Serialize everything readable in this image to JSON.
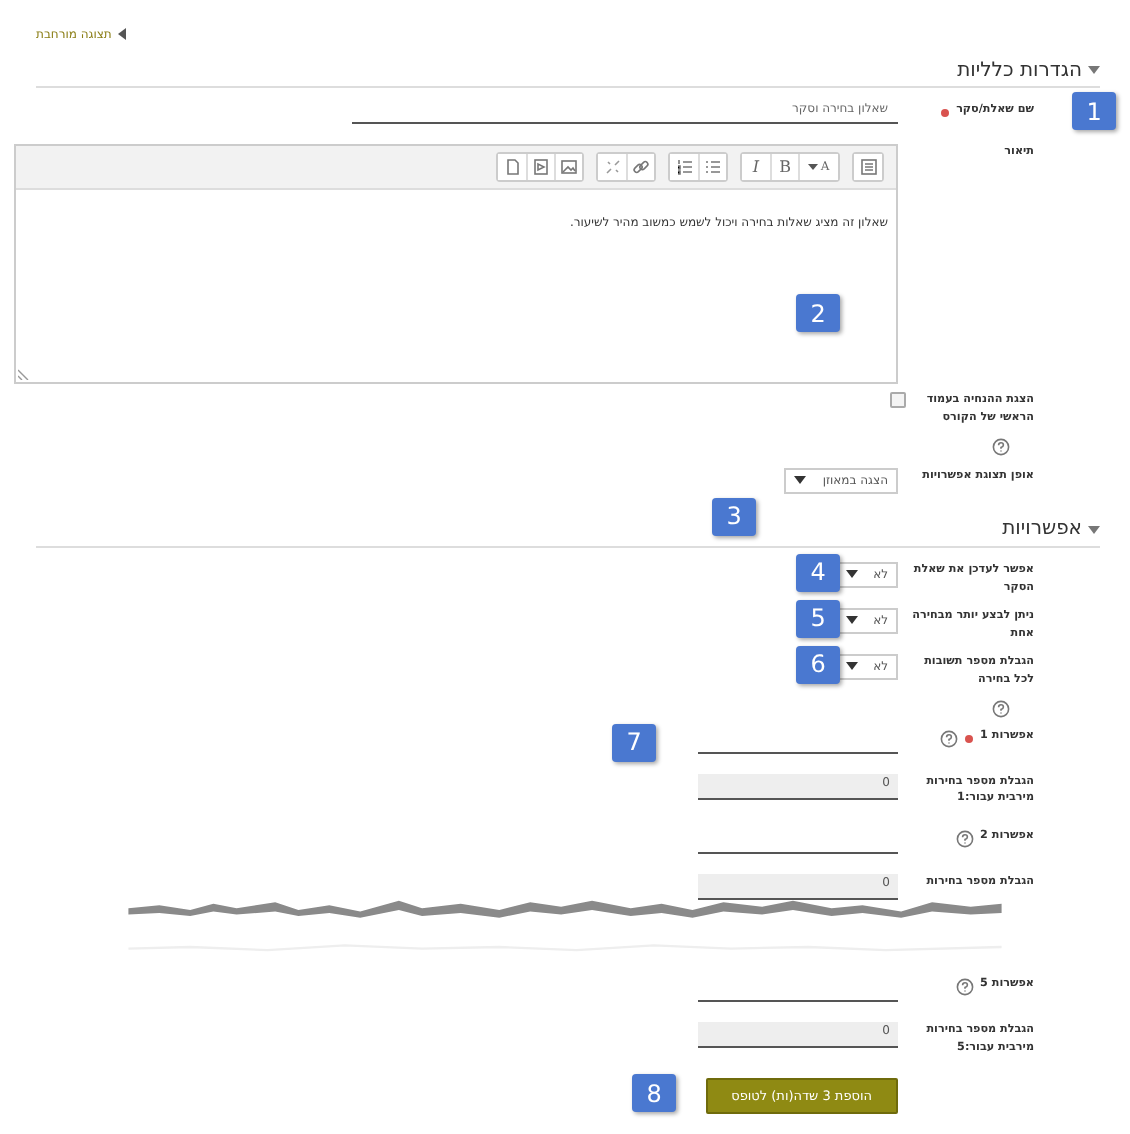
{
  "breadcrumb": {
    "label": "תצוגה מורחבת"
  },
  "sections": [
    {
      "title": "הגדרות כלליות",
      "expanded": true,
      "fields": [
        {
          "kind": "text",
          "label": "שם שאלת/סקר",
          "required": true,
          "value": "שאלון בחירה וסקר",
          "callout": "1"
        },
        {
          "kind": "editor",
          "label": "תיאור",
          "value": "שאלון זה מציג שאלות בחירה ויכול לשמש כמשוב מהיר לשיעור.",
          "callout": "2",
          "toolbar": [
            [
              {
                "kind": "more"
              }
            ],
            [
              {
                "kind": "style",
                "label": "A"
              },
              {
                "kind": "bold",
                "label": "B"
              },
              {
                "kind": "italic",
                "label": "I"
              }
            ],
            [
              {
                "kind": "ul"
              },
              {
                "kind": "ol"
              }
            ],
            [
              {
                "kind": "link"
              },
              {
                "kind": "unlink"
              }
            ],
            [
              {
                "kind": "image"
              },
              {
                "kind": "media"
              },
              {
                "kind": "file"
              }
            ]
          ]
        },
        {
          "kind": "checkbox",
          "label": "הצגת ההנחיה בעמוד הראשי של הקורס",
          "checked": false,
          "help": true
        },
        {
          "kind": "select",
          "label": "אופן תצוגת אפשרויות",
          "value": "הצגה במאוזן",
          "callout": "3"
        }
      ]
    },
    {
      "title": "אפשרויות",
      "expanded": true,
      "fields": [
        {
          "kind": "select",
          "label": "אפשר לעדכן את שאלת הסקר",
          "value": "לא",
          "callout": "4"
        },
        {
          "kind": "select",
          "label": "ניתן לבצע יותר מבחירה אחת",
          "value": "לא",
          "callout": "5"
        },
        {
          "kind": "select",
          "label": "הגבלת מספר תשובות לכל בחירה",
          "value": "לא",
          "help": true,
          "callout": "6"
        },
        {
          "kind": "text",
          "label": "אפשרות 1",
          "required": true,
          "help": true,
          "callout": "7"
        },
        {
          "kind": "number",
          "label": "הגבלת מספר בחירות מירבית עבור:1",
          "value": "0",
          "disabled": true
        },
        {
          "kind": "text",
          "label": "אפשרות 2",
          "help": true
        },
        {
          "kind": "number",
          "label": "הגבלת מספר בחירות",
          "value": "0",
          "disabled": true
        },
        {
          "kind": "tear"
        },
        {
          "kind": "text",
          "label": "אפשרות 5",
          "help": true
        },
        {
          "kind": "number",
          "label": "הגבלת מספר בחירות מירבית עבור:5",
          "value": "0",
          "disabled": true
        },
        {
          "kind": "button",
          "label": "הוספת 3 שדה(ות) לטופס",
          "callout": "8"
        }
      ]
    }
  ]
}
